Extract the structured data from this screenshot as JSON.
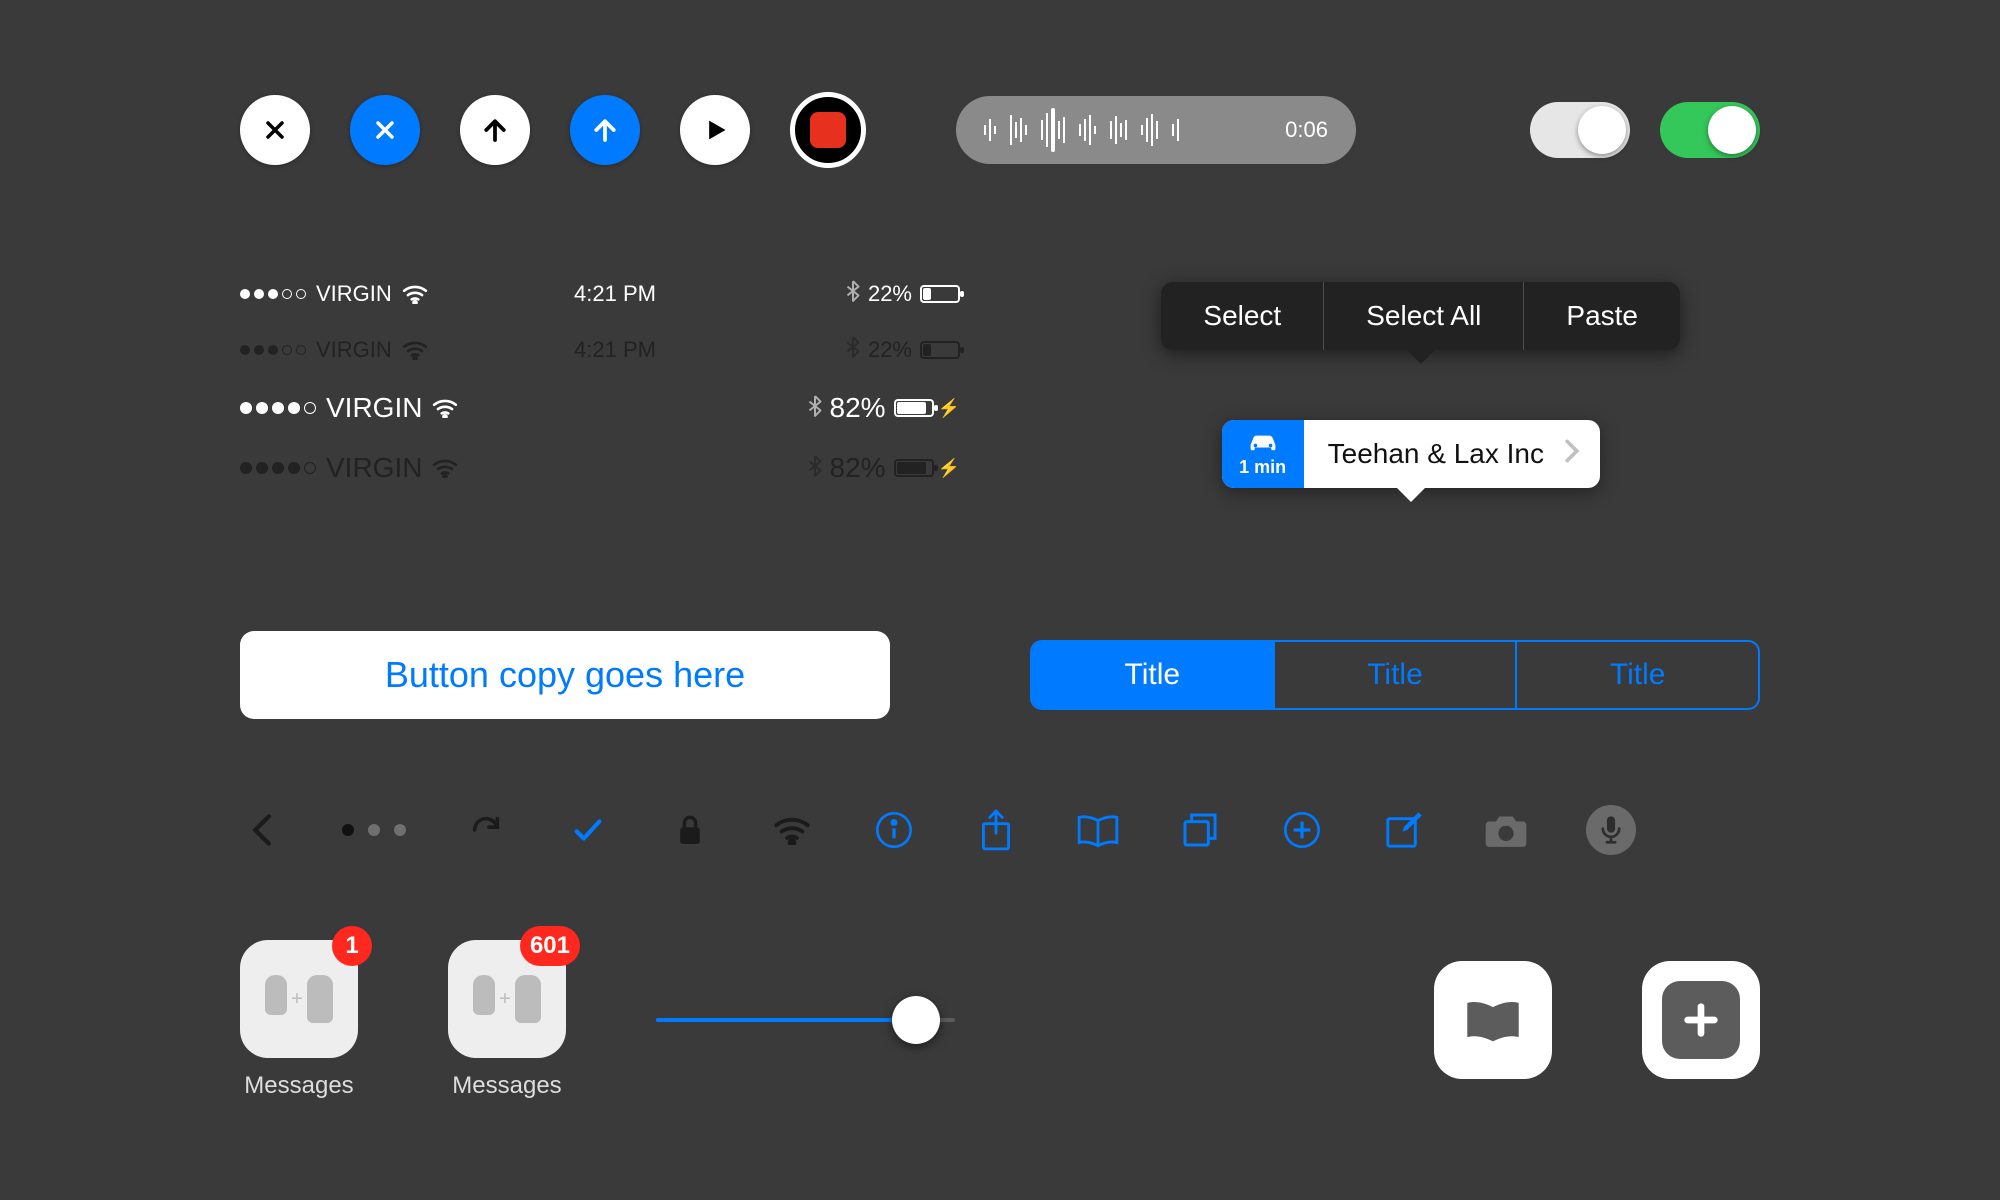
{
  "colors": {
    "accent": "#007aff",
    "green": "#34c759",
    "record": "#e8301f",
    "badge": "#ff281f"
  },
  "row1": {
    "waveform_time": "0:06",
    "toggle_off": false,
    "toggle_on": true
  },
  "statusbars": [
    {
      "carrier": "VIRGIN",
      "time": "4:21 PM",
      "battery_pct": "22%",
      "signal": 3,
      "signal_max": 5,
      "style": "light",
      "size": "small",
      "charging": false
    },
    {
      "carrier": "VIRGIN",
      "time": "4:21 PM",
      "battery_pct": "22%",
      "signal": 3,
      "signal_max": 5,
      "style": "dark",
      "size": "small",
      "charging": false
    },
    {
      "carrier": "VIRGIN",
      "time": "",
      "battery_pct": "82%",
      "signal": 4,
      "signal_max": 5,
      "style": "light",
      "size": "big",
      "charging": true
    },
    {
      "carrier": "VIRGIN",
      "time": "",
      "battery_pct": "82%",
      "signal": 4,
      "signal_max": 5,
      "style": "dark",
      "size": "big",
      "charging": true
    }
  ],
  "context_menu": {
    "items": [
      "Select",
      "Select All",
      "Paste"
    ]
  },
  "map_callout": {
    "eta": "1 min",
    "title": "Teehan & Lax Inc"
  },
  "big_button": {
    "label": "Button copy goes here"
  },
  "segmented": {
    "items": [
      "Title",
      "Title",
      "Title"
    ],
    "selected": 0
  },
  "toolbar": {
    "icons": [
      "chevron-left",
      "page-dots",
      "refresh",
      "check",
      "lock",
      "wifi",
      "info",
      "share",
      "book",
      "copy",
      "add",
      "compose",
      "camera",
      "mic"
    ]
  },
  "apps": [
    {
      "label": "Messages",
      "badge": "1"
    },
    {
      "label": "Messages",
      "badge": "601"
    }
  ],
  "slider": {
    "value": 0.87
  },
  "action_tiles": [
    "bookmark",
    "add"
  ]
}
